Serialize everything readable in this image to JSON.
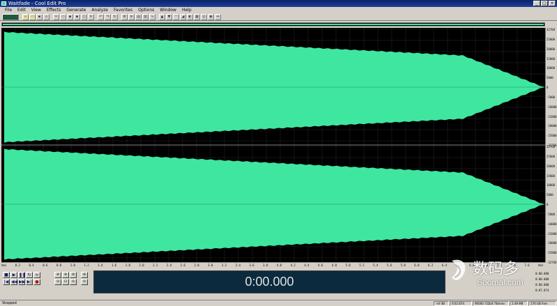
{
  "window": {
    "title": "Waitfade - Cool Edit Pro",
    "min": "_",
    "max": "□",
    "close": "×"
  },
  "menu": [
    "File",
    "Edit",
    "View",
    "Effects",
    "Generate",
    "Analyze",
    "Favorites",
    "Options",
    "Window",
    "Help"
  ],
  "colors": {
    "waveform": "#3fe6a0",
    "background": "#000000",
    "grid": "#2a2a2a"
  },
  "amplitude_ruler": {
    "channel1": [
      "32768",
      "25000",
      "20000",
      "15000",
      "10000",
      "5000",
      "0",
      "-5000",
      "-10000",
      "-15000",
      "-20000",
      "-25000",
      "-32768"
    ],
    "channel2": [
      "32768",
      "25000",
      "20000",
      "15000",
      "10000",
      "5000",
      "0",
      "-5000",
      "-10000",
      "-15000",
      "-20000",
      "-25000",
      "-32768"
    ]
  },
  "time_ruler": [
    "hms",
    "0.2",
    "0.4",
    "0.6",
    "0.8",
    "1.0",
    "1.2",
    "1.4",
    "1.6",
    "1.8",
    "2.0",
    "2.2",
    "2.4",
    "2.6",
    "2.8",
    "3.0",
    "3.2",
    "3.4",
    "3.6",
    "3.8",
    "4.0",
    "4.2",
    "4.4",
    "4.6",
    "4.8",
    "5.0",
    "5.2",
    "5.4",
    "5.6",
    "5.8",
    "6.0",
    "6.2",
    "6.4",
    "6.6",
    "6.8",
    "7.0",
    "7.2",
    "7.4",
    "7.6",
    "hms"
  ],
  "transport": {
    "time": "0:00.000"
  },
  "selection_view": {
    "sel_begin": "0:00.000",
    "view_begin": "0:00.000",
    "sel_end": "0:00.000",
    "view_end": "0:07.874",
    "len1": "0:00.000",
    "len2": "0:07.874"
  },
  "watermark": {
    "text": "数码多",
    "url": "Soomal.com"
  },
  "status": {
    "left": "Stopped",
    "level": "-inf dB",
    "time": "0:02.874",
    "format": "96000 ?32bit ?Stereo",
    "size": "2.49 MB",
    "free": "176 GB free"
  }
}
